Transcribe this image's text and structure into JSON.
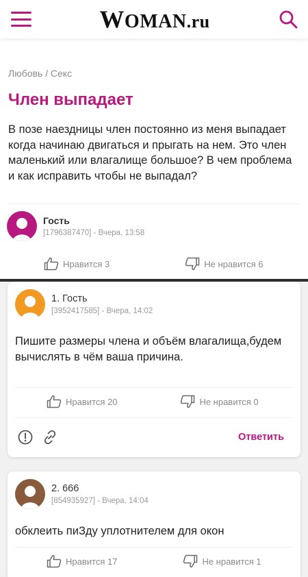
{
  "header": {
    "logo_big": "W",
    "logo_mid": "OMAN",
    "logo_suffix": ".ru",
    "accent": "#b7197e"
  },
  "topic": {
    "breadcrumb": "Любовь / Секс",
    "title": "Член выпадает",
    "question": "В позе наездницы член постоянно из меня выпадает когда начинаю двигаться и прыгать на нем. Это член маленький или влагалище большое? В чем проблема и как исправить чтобы не выпадал?",
    "author": "Гость",
    "meta": "[1796387470] - Вчера, 13:58",
    "likes": "Нравится 3",
    "dislikes": "Не нравится 6",
    "avatar_color": "#b7197e"
  },
  "comments": [
    {
      "number_author": "1. Гость",
      "meta": "[3952417585] - Вчера, 14:02",
      "text": "Пишите размеры члена и объём влагалища,будем вычислять в чём ваша причина.",
      "likes": "Нравится 20",
      "dislikes": "Не нравится 0",
      "reply_label": "Ответить",
      "avatar_color": "#f09a24"
    },
    {
      "number_author": "2. 666",
      "meta": "[854935927] - Вчера, 14:04",
      "text": "обклеить пиЗду уплотнителем для окон",
      "likes": "Нравится 17",
      "dislikes": "Не нравится 1",
      "avatar_color": "#8a5a3c"
    }
  ],
  "icons": {
    "menu": "burger-menu-icon",
    "search": "search-icon",
    "like": "thumbs-up-icon",
    "dislike": "thumbs-down-icon",
    "report": "warning-icon",
    "link": "link-icon",
    "avatar": "user-silhouette-icon"
  }
}
